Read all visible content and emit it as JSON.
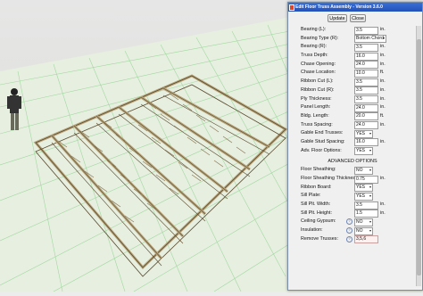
{
  "dialog": {
    "title": "Edit Floor Truss Assembly - Version 3.6.0",
    "update_label": "Update",
    "close_label": "Close"
  },
  "fields": [
    {
      "label": "Bearing (L):",
      "value": "3.5",
      "unit": "in."
    },
    {
      "label": "Bearing Type (R):",
      "value": "Bottom Chord",
      "type": "dropdown"
    },
    {
      "label": "Bearing (R):",
      "value": "3.5",
      "unit": "in."
    },
    {
      "label": "Truss Depth:",
      "value": "16.0",
      "unit": "in."
    },
    {
      "label": "Chase Opening:",
      "value": "24.0",
      "unit": "in."
    },
    {
      "label": "Chase Location:",
      "value": "10.0",
      "unit": "ft."
    },
    {
      "label": "Ribbon Cut (L):",
      "value": "3.5",
      "unit": "in."
    },
    {
      "label": "Ribbon Cut (R):",
      "value": "3.5",
      "unit": "in."
    },
    {
      "label": "Ply Thickness:",
      "value": "3.5",
      "unit": "in."
    },
    {
      "label": "Panel Length:",
      "value": "24.0",
      "unit": "in."
    },
    {
      "label": "Bldg. Length:",
      "value": "20.0",
      "unit": "ft."
    },
    {
      "label": "Truss Spacing:",
      "value": "24.0",
      "unit": "in."
    },
    {
      "label": "Gable End Trusses:",
      "value": "YES",
      "type": "dropdown"
    },
    {
      "label": "Gable Stud Spacing:",
      "value": "16.0",
      "unit": "in."
    },
    {
      "label": "Adv. Floor Options:",
      "value": "YES",
      "type": "dropdown"
    }
  ],
  "advanced_title": "ADVANCED OPTIONS",
  "advanced": [
    {
      "label": "Floor Sheathing:",
      "value": "NO",
      "type": "dropdown"
    },
    {
      "label": "Floor Sheathing Thickness:",
      "value": "0.75",
      "unit": "in."
    },
    {
      "label": "Ribbon Board:",
      "value": "YES",
      "type": "dropdown"
    },
    {
      "label": "Sill Plate:",
      "value": "YES",
      "type": "dropdown"
    },
    {
      "label": "Sill Plt. Width:",
      "value": "3.5",
      "unit": "in."
    },
    {
      "label": "Sill Plt. Height:",
      "value": "1.5",
      "unit": "in."
    },
    {
      "label": "Ceiling Gypsum:",
      "value": "NO",
      "type": "dropdown",
      "help": true
    },
    {
      "label": "Insulation:",
      "value": "NO",
      "type": "dropdown",
      "help": true
    },
    {
      "label": "Remove Trusses:",
      "value": "3,5,6",
      "type": "text-red",
      "help": true
    }
  ],
  "colors": {
    "grid": "#8fd38f",
    "ground": "#d8e8c8",
    "wood": "#d8c9a8",
    "wood_dark": "#7a6a4a",
    "sky": "#e4e4e4"
  }
}
